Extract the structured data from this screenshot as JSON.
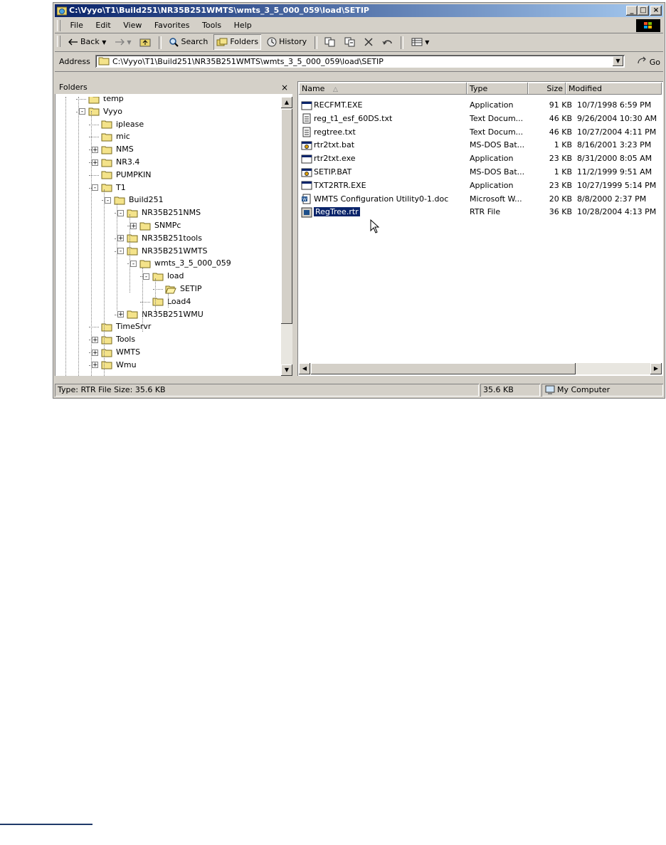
{
  "window": {
    "title": "C:\\Vyyo\\T1\\Build251\\NR35B251WMTS\\wmts_3_5_000_059\\load\\SETIP"
  },
  "menu": [
    "File",
    "Edit",
    "View",
    "Favorites",
    "Tools",
    "Help"
  ],
  "toolbar": {
    "back_label": "Back",
    "search_label": "Search",
    "folders_label": "Folders",
    "history_label": "History"
  },
  "address": {
    "label": "Address",
    "value": "C:\\Vyyo\\T1\\Build251\\NR35B251WMTS\\wmts_3_5_000_059\\load\\SETIP",
    "go_label": "Go"
  },
  "folders_pane": {
    "title": "Folders",
    "close_glyph": "×",
    "tree": [
      {
        "label": "temp",
        "expander": ""
      },
      {
        "label": "Vyyo",
        "expander": "-"
      },
      {
        "label": "iplease",
        "expander": ""
      },
      {
        "label": "mic",
        "expander": ""
      },
      {
        "label": "NMS",
        "expander": "+"
      },
      {
        "label": "NR3.4",
        "expander": "+"
      },
      {
        "label": "PUMPKIN",
        "expander": ""
      },
      {
        "label": "T1",
        "expander": "-"
      },
      {
        "label": "Build251",
        "expander": "-"
      },
      {
        "label": "NR35B251NMS",
        "expander": "-"
      },
      {
        "label": "SNMPc",
        "expander": "+"
      },
      {
        "label": "NR35B251tools",
        "expander": "+"
      },
      {
        "label": "NR35B251WMTS",
        "expander": "-"
      },
      {
        "label": "wmts_3_5_000_059",
        "expander": "-"
      },
      {
        "label": "load",
        "expander": "-"
      },
      {
        "label": "SETIP",
        "expander": ""
      },
      {
        "label": "Load4",
        "expander": ""
      },
      {
        "label": "NR35B251WMU",
        "expander": "+"
      },
      {
        "label": "TimeSrvr",
        "expander": ""
      },
      {
        "label": "Tools",
        "expander": "+"
      },
      {
        "label": "WMTS",
        "expander": "+"
      },
      {
        "label": "Wmu",
        "expander": "+"
      }
    ]
  },
  "file_list": {
    "columns": {
      "name": "Name",
      "type": "Type",
      "size": "Size",
      "modified": "Modified"
    },
    "sort_indicator": "△",
    "rows": [
      {
        "name": "RECFMT.EXE",
        "type": "Application",
        "size": "91 KB",
        "modified": "10/7/1998 6:59 PM",
        "icon": "app-icon"
      },
      {
        "name": "reg_t1_esf_60DS.txt",
        "type": "Text Docum...",
        "size": "46 KB",
        "modified": "9/26/2004 10:30 AM",
        "icon": "text-doc-icon"
      },
      {
        "name": "regtree.txt",
        "type": "Text Docum...",
        "size": "46 KB",
        "modified": "10/27/2004 4:11 PM",
        "icon": "text-doc-icon"
      },
      {
        "name": "rtr2txt.bat",
        "type": "MS-DOS Bat...",
        "size": "1 KB",
        "modified": "8/16/2001 3:23 PM",
        "icon": "batch-icon"
      },
      {
        "name": "rtr2txt.exe",
        "type": "Application",
        "size": "23 KB",
        "modified": "8/31/2000 8:05 AM",
        "icon": "app-icon"
      },
      {
        "name": "SETIP.BAT",
        "type": "MS-DOS Bat...",
        "size": "1 KB",
        "modified": "11/2/1999 9:51 AM",
        "icon": "batch-icon"
      },
      {
        "name": "TXT2RTR.EXE",
        "type": "Application",
        "size": "23 KB",
        "modified": "10/27/1999 5:14 PM",
        "icon": "app-icon"
      },
      {
        "name": "WMTS Configuration Utility0-1.doc",
        "type": "Microsoft W...",
        "size": "20 KB",
        "modified": "8/8/2000 2:37 PM",
        "icon": "word-doc-icon"
      },
      {
        "name": "RegTree.rtr",
        "type": "RTR File",
        "size": "36 KB",
        "modified": "10/28/2004 4:13 PM",
        "icon": "rtr-file-icon",
        "selected": true
      }
    ]
  },
  "status_bar": {
    "info": "Type: RTR File Size: 35.6 KB",
    "size": "35.6 KB",
    "zone": "My Computer"
  }
}
